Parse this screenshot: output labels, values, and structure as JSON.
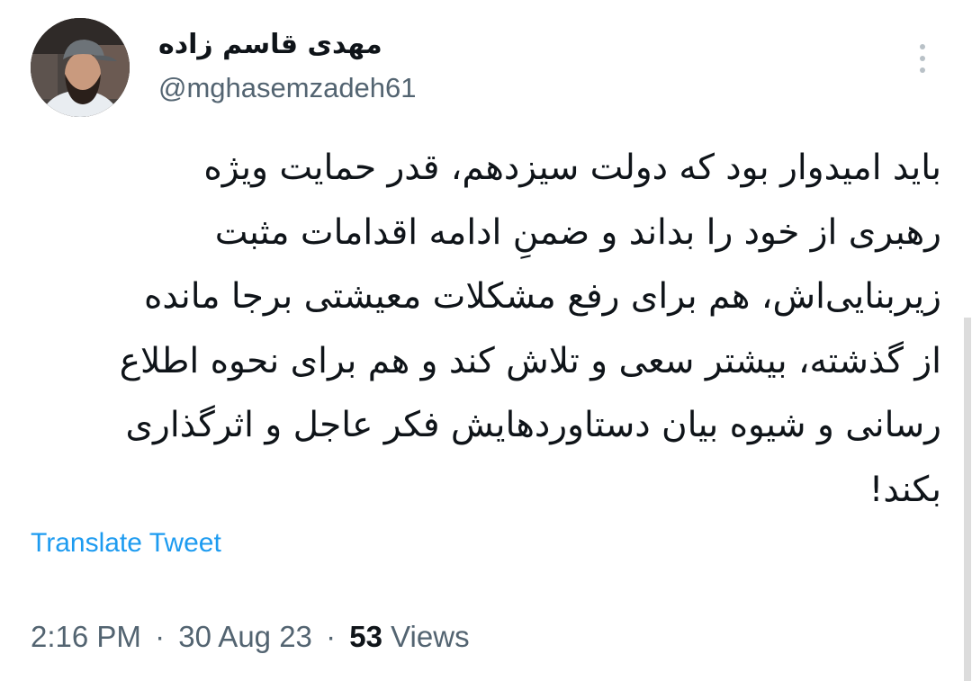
{
  "author": {
    "display_name": "مهدی قاسم زاده",
    "handle": "@mghasemzadeh61"
  },
  "more_menu_icon": "more-vertical-icon",
  "tweet": {
    "lines": [
      "باید امیدوار بود که دولت سیزدهم، قدر حمایت ویژه",
      "رهبری از خود را بداند و ضمنِ ادامه اقدامات مثبت",
      "زیربنایی‌اش، هم برای رفع مشکلات معیشتی برجا مانده",
      "از گذشته، بیشتر سعی و تلاش کند و هم برای نحوه اطلاع",
      "رسانی و شیوه بیان دستاوردهایش فکر عاجل و اثرگذاری",
      "بکند!"
    ]
  },
  "translate_label": "Translate Tweet",
  "meta": {
    "time": "2:16 PM",
    "separator": "·",
    "date": "30 Aug 23",
    "views_count": "53",
    "views_label": "Views"
  },
  "colors": {
    "text": "#0f1419",
    "secondary": "#536471",
    "link": "#1d9bf0"
  }
}
